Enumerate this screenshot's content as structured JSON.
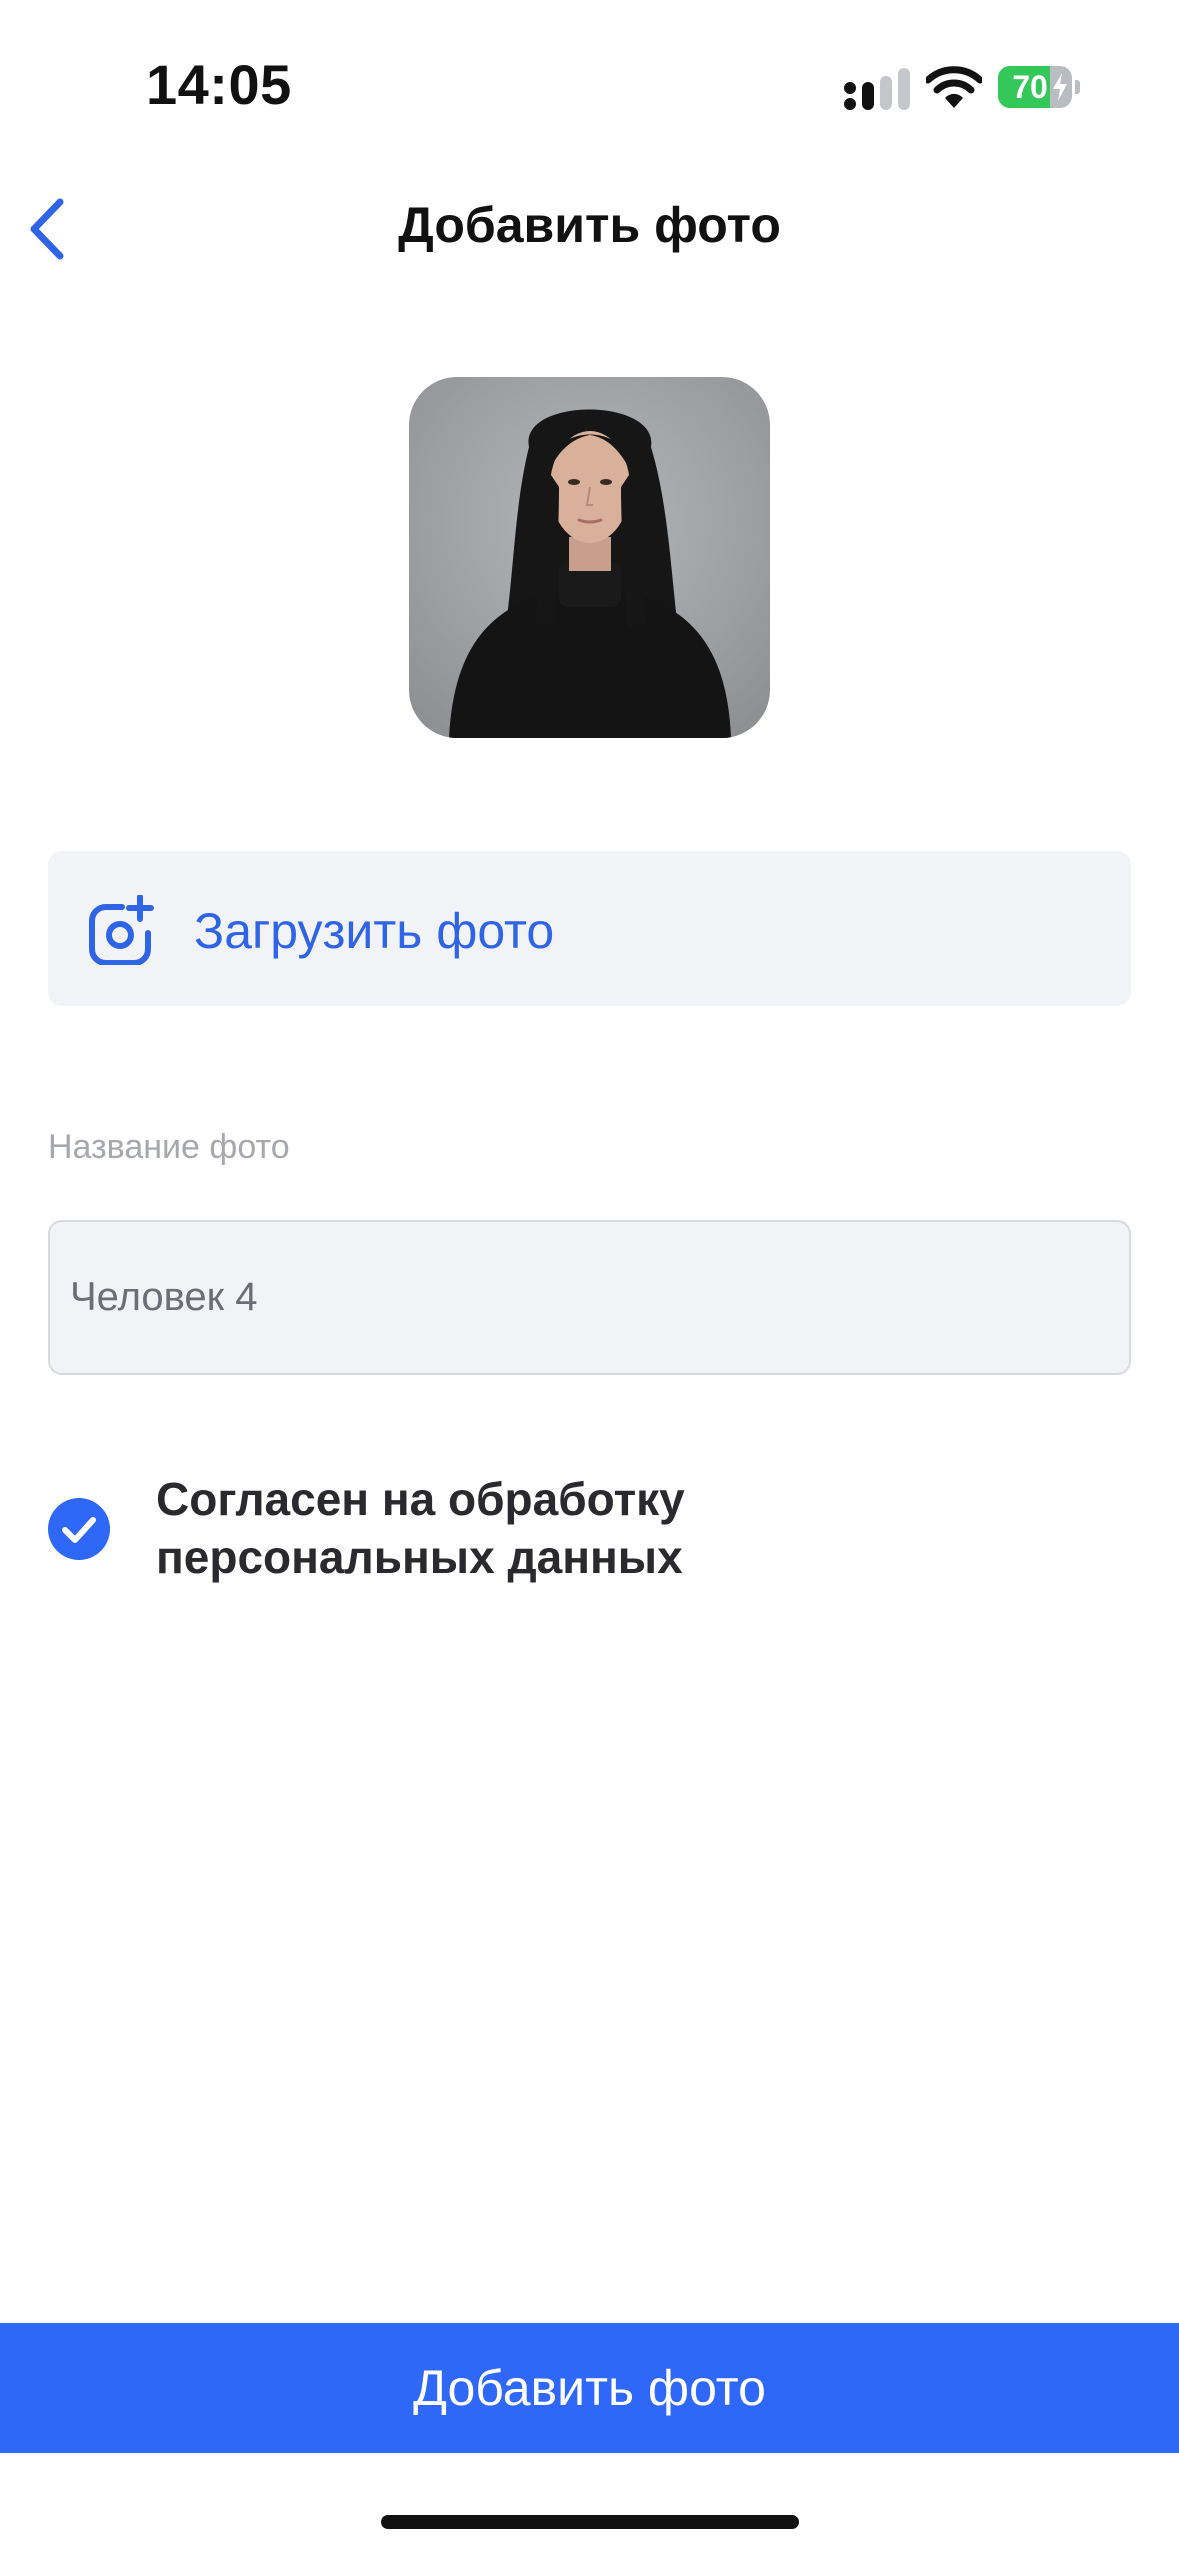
{
  "status_bar": {
    "time": "14:05",
    "battery_level": "70",
    "battery_fill_fraction": 0.7,
    "icons": [
      "cellular-signal-icon",
      "wifi-icon",
      "battery-charging-icon"
    ]
  },
  "nav": {
    "back_icon": "chevron-left-icon",
    "title": "Добавить фото"
  },
  "photo": {
    "icon": "portrait-photo"
  },
  "upload": {
    "icon": "camera-plus-icon",
    "label": "Загрузить фото"
  },
  "name_field": {
    "label": "Название фото",
    "value": "Человек 4"
  },
  "consent": {
    "checked": true,
    "line1": "Согласен на обработку",
    "line2": "персональных данных"
  },
  "submit": {
    "label": "Добавить фото"
  },
  "colors": {
    "accent": "#2f68f8",
    "link": "#2f64e6",
    "battery_green": "#34c759",
    "field_bg": "#f2f3f6"
  }
}
